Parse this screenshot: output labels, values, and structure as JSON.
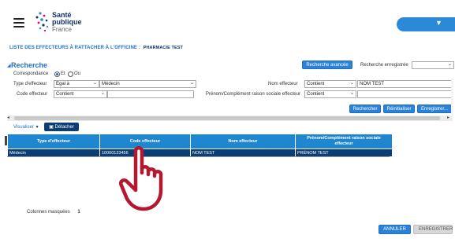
{
  "colors": {
    "accent": "#2b82d6",
    "grid_header": "#1f86d1",
    "grid_row_selected": "#0b3e74",
    "cursor": "#b3182e"
  },
  "header": {
    "logo": {
      "line1": "Santé",
      "line2": "publique",
      "line3": "France"
    },
    "user_menu_caret": "▼"
  },
  "page_title": {
    "text": "LISTE DES EFFECTEURS À RATTACHER À L'OFFICINE :",
    "officine": "PHARMACIE TEST"
  },
  "search": {
    "section_title": "Recherche",
    "advanced_button": "Recherche avancée",
    "saved_search_label": "Recherche enregistrée",
    "saved_search_value": "",
    "correspondence_label": "Correspondance",
    "radio_and": "Et",
    "radio_or": "Ou",
    "type_label": "Type d'effecteur",
    "type_operator": "Égal à",
    "type_value": "Médecin",
    "code_label": "Code effecteur",
    "code_operator": "Contient",
    "code_value": "",
    "name_label": "Nom effecteur",
    "name_operator": "Contient",
    "name_value": "NOM TEST",
    "firstname_label": "Prénom/Complément raison sociale effecteur",
    "firstname_operator": "Contient",
    "firstname_value": "",
    "search_button": "Rechercher",
    "reset_button": "Réinitialiser",
    "save_button": "Enregistrer..."
  },
  "results": {
    "view_menu": "Visualiser",
    "detach_button": "Détacher",
    "columns": [
      "Type d'effecteur",
      "Code effecteur",
      "Nom effecteur",
      "Prénom/Complément raison sociale effecteur"
    ],
    "rows": [
      {
        "type": "Médecin",
        "code": "10000123456",
        "name": "NOM TEST",
        "firstname": "PRÉNOM TEST"
      }
    ],
    "hidden_columns_label": "Colonnes masquées",
    "hidden_columns_count": "1"
  },
  "footer": {
    "cancel_button": "ANNULER",
    "save_button": "ENREGISTRER"
  }
}
